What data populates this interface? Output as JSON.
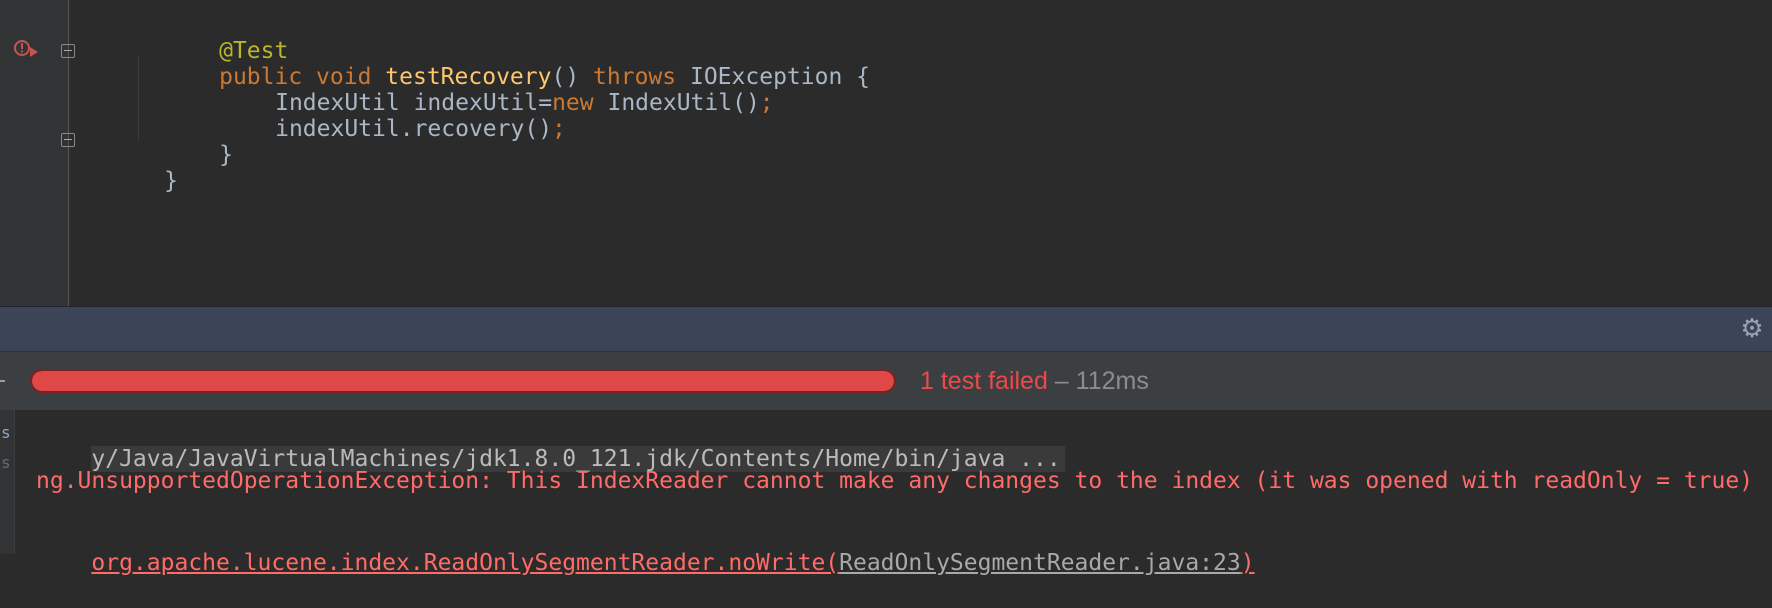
{
  "editor": {
    "annotation": "@Test",
    "method_line": {
      "public_kw": "public",
      "void_kw": "void",
      "method_name": "testRecovery",
      "parens": "()",
      "throws_kw": "throws",
      "exception": "IOException",
      "open_brace": "{"
    },
    "line_decl": {
      "type": "IndexUtil",
      "var": "indexUtil=",
      "new_kw": "new",
      "ctor": "IndexUtil()",
      "semicolon": ";"
    },
    "line_call": {
      "call": "indexUtil.recovery()",
      "semicolon": ";"
    },
    "method_close": "}",
    "class_close": "}"
  },
  "test_runner": {
    "status_failed": "1 test failed",
    "status_duration": " – 112ms",
    "progress_fraction": 1.0,
    "progress_color": "#e04848"
  },
  "console": {
    "side_chars": [
      "s",
      "s"
    ],
    "command": "y/Java/JavaVirtualMachines/jdk1.8.0_121.jdk/Contents/Home/bin/java ...",
    "exception": "ng.UnsupportedOperationException: This IndexReader cannot make any changes to the index (it was opened with readOnly = true)",
    "trace_prefix": "org.apache.lucene.index.ReadOnlySegmentReader.noWrite(",
    "trace_source": "ReadOnlySegmentReader.java:23",
    "trace_suffix": ")"
  },
  "icons": {
    "run_error": "run-failed-icon",
    "gear": "gear-icon"
  }
}
